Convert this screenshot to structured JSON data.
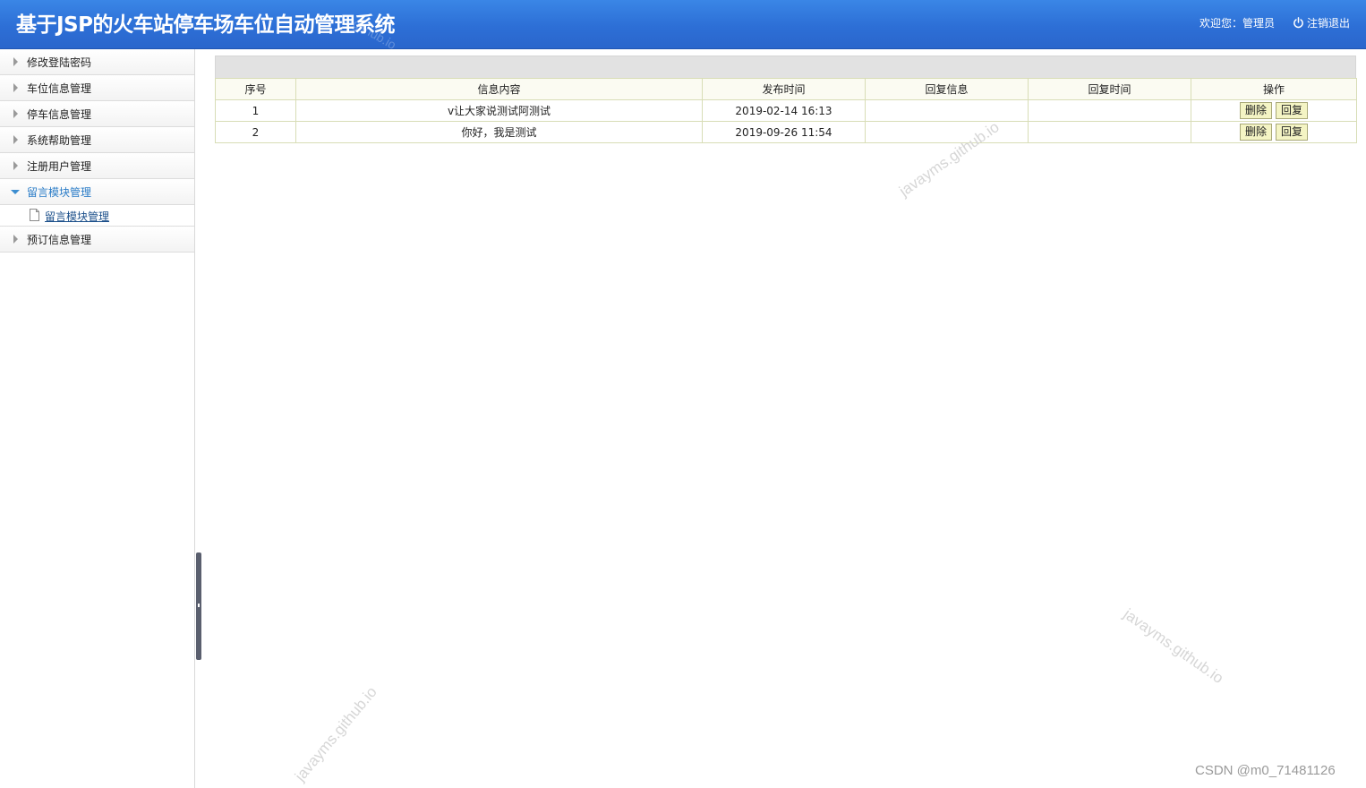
{
  "header": {
    "title": "基于JSP的火车站停车场车位自动管理系统",
    "welcome": "欢迎您：管理员",
    "logout_label": "注销退出",
    "logout_icon": "power-icon"
  },
  "sidebar": {
    "items": [
      {
        "label": "修改登陆密码"
      },
      {
        "label": "车位信息管理"
      },
      {
        "label": "停车信息管理"
      },
      {
        "label": "系统帮助管理"
      },
      {
        "label": "注册用户管理"
      },
      {
        "label": "留言模块管理",
        "expanded": true
      },
      {
        "label": "预订信息管理"
      }
    ],
    "subitem": {
      "label": "留言模块管理",
      "icon": "document-icon"
    }
  },
  "table": {
    "headers": [
      "序号",
      "信息内容",
      "发布时间",
      "回复信息",
      "回复时间",
      "操作"
    ],
    "rows": [
      {
        "index": "1",
        "content": "v让大家说测试阿测试",
        "time": "2019-02-14 16:13",
        "reply": "",
        "reply_time": "",
        "delete": "删除",
        "reply_btn": "回复"
      },
      {
        "index": "2",
        "content": "你好，我是测试",
        "time": "2019-09-26 11:54",
        "reply": "",
        "reply_time": "",
        "delete": "删除",
        "reply_btn": "回复"
      }
    ]
  },
  "watermarks": {
    "text": "javayms.github.io",
    "top_fragment": "github.io"
  },
  "footer_credit": "CSDN @m0_71481126",
  "colors": {
    "header_blue": "#2d6fd6",
    "active_nav": "#2a7cc7",
    "button_bg": "#f4f4c4"
  }
}
